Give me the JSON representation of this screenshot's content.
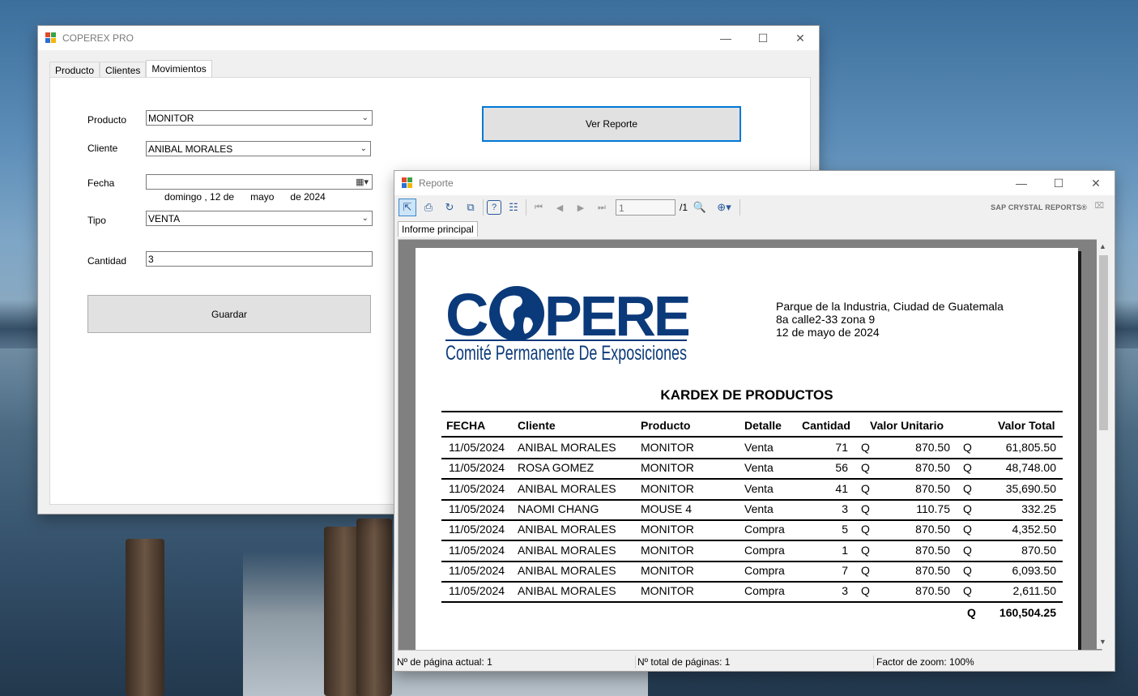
{
  "main_window": {
    "title": "COPEREX PRO",
    "tabs": [
      "Producto",
      "Clientes",
      "Movimientos"
    ],
    "active_tab": "Movimientos",
    "form": {
      "producto_label": "Producto",
      "producto_value": "MONITOR",
      "cliente_label": "Cliente",
      "cliente_value": "ANIBAL MORALES",
      "fecha_label": "Fecha",
      "fecha_value": "domingo , 12 de      mayo      de 2024",
      "tipo_label": "Tipo",
      "tipo_value": "VENTA",
      "cantidad_label": "Cantidad",
      "cantidad_value": "3"
    },
    "guardar_label": "Guardar",
    "ver_reporte_label": "Ver Reporte"
  },
  "report_window": {
    "title": "Reporte",
    "page_input": "1",
    "page_total": "/1",
    "brand": "SAP CRYSTAL REPORTS®",
    "tab_label": "Informe principal",
    "status": {
      "current_page": "Nº de página actual: 1",
      "total_pages": "Nº total de páginas: 1",
      "zoom": "Factor de zoom: 100%"
    }
  },
  "report": {
    "logo_text": "COPEREX",
    "logo_subtitle": "Comité Permanente De Exposiciones",
    "address_lines": [
      "Parque de la Industria, Ciudad de Guatemala",
      "8a calle2-33 zona 9",
      "12 de mayo de 2024"
    ],
    "title": "KARDEX DE PRODUCTOS",
    "columns": [
      "FECHA",
      "Cliente",
      "Producto",
      "Detalle",
      "Cantidad",
      "Valor Unitario",
      "Valor Total"
    ],
    "currency": "Q",
    "rows": [
      [
        "11/05/2024",
        "ANIBAL MORALES",
        "MONITOR",
        "Venta",
        "71",
        "870.50",
        "61,805.50"
      ],
      [
        "11/05/2024",
        "ROSA GOMEZ",
        "MONITOR",
        "Venta",
        "56",
        "870.50",
        "48,748.00"
      ],
      [
        "11/05/2024",
        "ANIBAL MORALES",
        "MONITOR",
        "Venta",
        "41",
        "870.50",
        "35,690.50"
      ],
      [
        "11/05/2024",
        "NAOMI CHANG",
        "MOUSE 4",
        "Venta",
        "3",
        "110.75",
        "332.25"
      ],
      [
        "11/05/2024",
        "ANIBAL MORALES",
        "MONITOR",
        "Compra",
        "5",
        "870.50",
        "4,352.50"
      ],
      [
        "11/05/2024",
        "ANIBAL MORALES",
        "MONITOR",
        "Compra",
        "1",
        "870.50",
        "870.50"
      ],
      [
        "11/05/2024",
        "ANIBAL MORALES",
        "MONITOR",
        "Compra",
        "7",
        "870.50",
        "6,093.50"
      ],
      [
        "11/05/2024",
        "ANIBAL MORALES",
        "MONITOR",
        "Compra",
        "3",
        "870.50",
        "2,611.50"
      ]
    ],
    "total": "160,504.25"
  },
  "colors": {
    "accent": "#0078d7",
    "logo_blue": "#0b3a7a"
  }
}
